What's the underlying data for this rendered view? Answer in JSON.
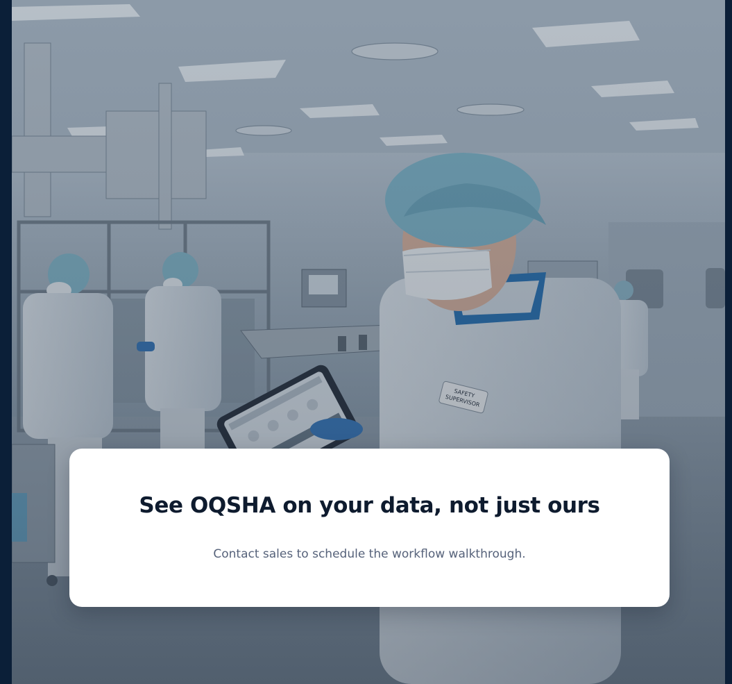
{
  "hero": {
    "image_description": "Cleanroom manufacturing floor with workers in hairnets and white coats; safety supervisor holding a tablet",
    "badge_line1": "SAFETY",
    "badge_line2": "SUPERVISOR"
  },
  "cta": {
    "title": "See OQSHA on your data, not just ours",
    "subtitle": "Contact sales to schedule the workflow walkthrough."
  },
  "colors": {
    "page_background": "#0b1f38",
    "card_background": "#ffffff",
    "title_color": "#0e1b2e",
    "subtitle_color": "#56627a"
  }
}
